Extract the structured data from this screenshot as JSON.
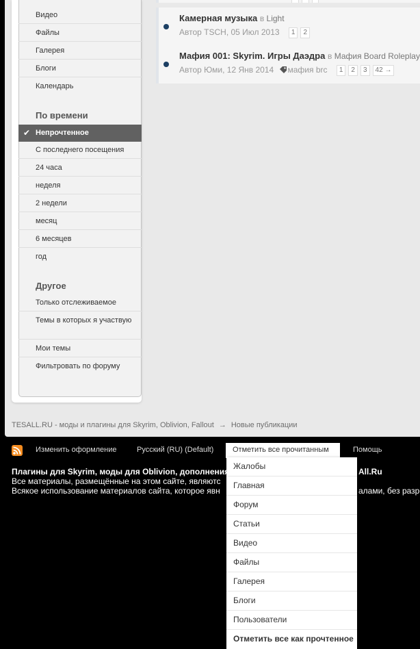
{
  "sidebar": {
    "items_top": [
      {
        "label": "Видео"
      },
      {
        "label": "Файлы"
      },
      {
        "label": "Галерея"
      },
      {
        "label": "Блоги"
      },
      {
        "label": "Календарь"
      }
    ],
    "time_heading": "По времени",
    "time_items": [
      {
        "label": "Непрочтенное",
        "active": true
      },
      {
        "label": "С последнего посещения"
      },
      {
        "label": "24 часа"
      },
      {
        "label": "неделя"
      },
      {
        "label": "2 недели"
      },
      {
        "label": "месяц"
      },
      {
        "label": "6 месяцев"
      },
      {
        "label": "год"
      }
    ],
    "other_heading": "Другое",
    "other_items": [
      {
        "label": "Только отслеживаемое"
      },
      {
        "label": "Темы в которых я участвую"
      },
      {
        "label": "Мои темы"
      },
      {
        "label": "Фильтровать по форуму"
      }
    ]
  },
  "topics": [
    {
      "title": "Камерная музыка",
      "in_word": "в",
      "forum": "Light",
      "meta": "Автор TSCH, 05 Июл 2013",
      "pages": [
        "1",
        "2"
      ]
    },
    {
      "title": "Мафия 001: Skyrim. Игры Даэдра",
      "in_word": "в",
      "forum": "Мафия Board Roleplay",
      "meta": "Автор Юми, 12 Янв 2014",
      "tag": "мафия brc",
      "pages": [
        "1",
        "2",
        "3",
        "42 →"
      ]
    }
  ],
  "breadcrumb": {
    "site": "TESALL.RU - моды и плагины для Skyrim, Oblivion, Fallout",
    "arrow": "→",
    "current": "Новые публикации"
  },
  "footer": {
    "change_theme": "Изменить оформление",
    "language": "Русский (RU) (Default)",
    "mark_all_read": "Отметить все прочитанным",
    "help": "Помощь",
    "copy_line1": "Плагины для Skyrim, моды для Oblivion, дополнения",
    "copy_line1_right": "All.Ru",
    "copy_line2": "Все материалы, размещённые на этом сайте, являютс",
    "copy_line3": "Всякое использование материалов сайта, которое явн",
    "copy_line3_right": "алами, без разре"
  },
  "dropdown": {
    "items": [
      "Жалобы",
      "Главная",
      "Форум",
      "Статьи",
      "Видео",
      "Файлы",
      "Галерея",
      "Блоги",
      "Пользователи"
    ],
    "last": "Отметить все как прочтенное"
  },
  "colors": {
    "active_bg": "#616161",
    "unread_dot": "#1c3f63",
    "rss": "#f38b1f"
  }
}
